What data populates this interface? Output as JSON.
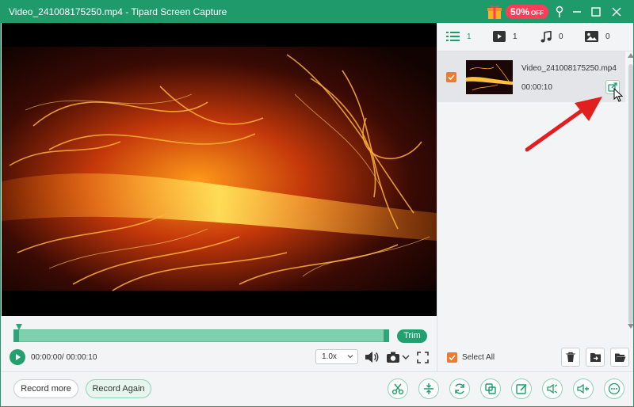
{
  "window": {
    "title": "Video_241008175250.mp4 - Tipard Screen Capture"
  },
  "promo": {
    "discount": "50%",
    "off": "OFF",
    "icon": "gift-icon"
  },
  "window_controls": [
    "pin-icon",
    "minimize-icon",
    "maximize-icon",
    "close-icon"
  ],
  "player": {
    "trim_label": "Trim",
    "time": "00:00:00/ 00:00:10",
    "speed": "1.0x"
  },
  "bottom_bar": {
    "record_more": "Record more",
    "record_again": "Record Again",
    "tools": [
      "scissors-icon",
      "split-icon",
      "convert-icon",
      "merge-icon",
      "edit-icon",
      "audio-icon",
      "volume-boost-icon",
      "more-icon"
    ]
  },
  "panel": {
    "tabs": [
      {
        "icon": "list-icon",
        "count": "1"
      },
      {
        "icon": "video-icon",
        "count": "1"
      },
      {
        "icon": "music-icon",
        "count": "0"
      },
      {
        "icon": "image-icon",
        "count": "0"
      }
    ],
    "item": {
      "name": "Video_241008175250.mp4",
      "duration": "00:00:10",
      "checked": true
    },
    "select_all": "Select All",
    "actions": [
      "delete-icon",
      "move-to-folder-icon",
      "open-folder-icon"
    ]
  },
  "colors": {
    "brand_green": "#1f9b6b",
    "accent_orange": "#f07a2b",
    "promo_red": "#ff3d57",
    "annotation_red": "#e21f1f"
  }
}
